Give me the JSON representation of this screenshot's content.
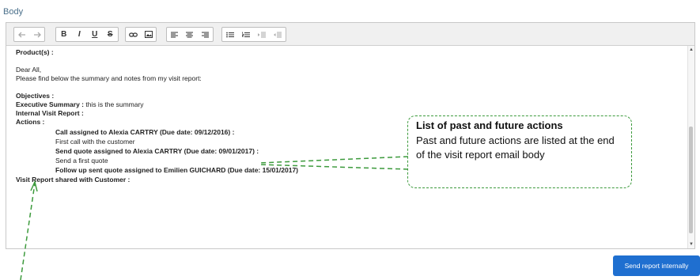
{
  "section": {
    "label": "Body"
  },
  "toolbar": {
    "groups": [
      [
        "undo-icon",
        "redo-icon"
      ],
      [
        "bold",
        "italic",
        "underline",
        "strikethrough"
      ],
      [
        "link-icon",
        "image-icon"
      ],
      [
        "align-left-icon",
        "align-center-icon",
        "align-right-icon"
      ],
      [
        "bulleted-list-icon",
        "numbered-list-icon",
        "indent-icon",
        "outdent-icon"
      ]
    ],
    "labels": {
      "bold": "B",
      "italic": "I",
      "underline": "U",
      "strikethrough": "S"
    }
  },
  "content": {
    "products_heading": "Product(s) :",
    "greeting": "Dear All,",
    "intro": "Please find below the summary and notes from my visit report:",
    "objectives": "Objectives :",
    "exec_summary_label": "Executive Summary :",
    "exec_summary_value": " this is the summary",
    "internal_report": "Internal Visit Report :",
    "actions_heading": "Actions :",
    "actions": [
      {
        "title": "Call assigned to Alexia CARTRY (Due date: 09/12/2016) :",
        "note": "First call with the customer"
      },
      {
        "title": "Send quote assigned to Alexia CARTRY (Due date: 09/01/2017) :",
        "note": "Send a first quote"
      },
      {
        "title": "Follow up sent quote assigned to Emilien GUICHARD (Due date: 15/01/2017)",
        "note": ""
      }
    ],
    "shared": "Visit Report shared with Customer :"
  },
  "callout": {
    "title": "List of past and future actions",
    "body": "Past and future actions are listed at the end of the visit report email body"
  },
  "send_button": {
    "label": "Send report internally"
  },
  "colors": {
    "accent": "#1f6fd0",
    "annotation": "#3c9a3c",
    "label": "#4a6f8a"
  }
}
